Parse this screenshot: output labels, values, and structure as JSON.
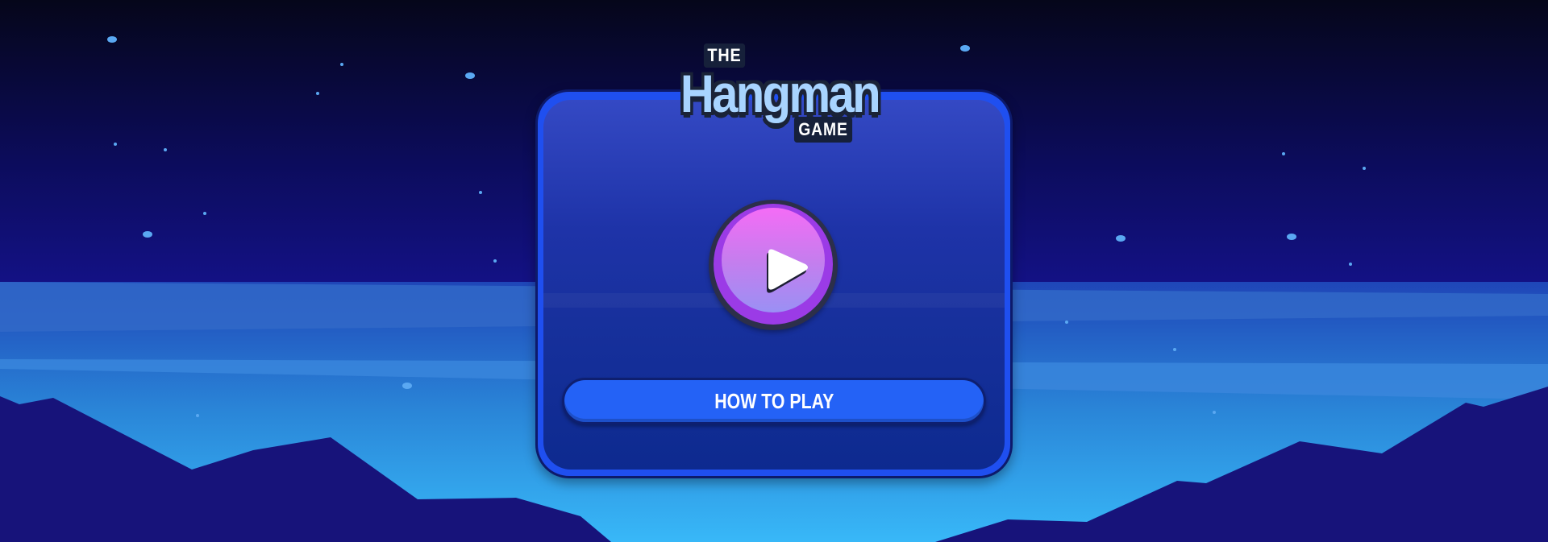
{
  "game": {
    "logo": {
      "the": "THE",
      "title": "Hangman",
      "game": "GAME"
    },
    "play_button": {
      "icon": "play-icon"
    },
    "how_to_play_label": "HOW TO PLAY"
  },
  "colors": {
    "sky_top": "#05061a",
    "sky_mid": "#12117e",
    "card_border": "#1f4ff0",
    "card_fill": "#1e33a8",
    "play_button": "#e96cf5",
    "how_to_play_button": "#2462f6",
    "logo_text": "#a8d4ff",
    "mountains": "#17137a",
    "horizon_glow": "#35b4f5"
  }
}
